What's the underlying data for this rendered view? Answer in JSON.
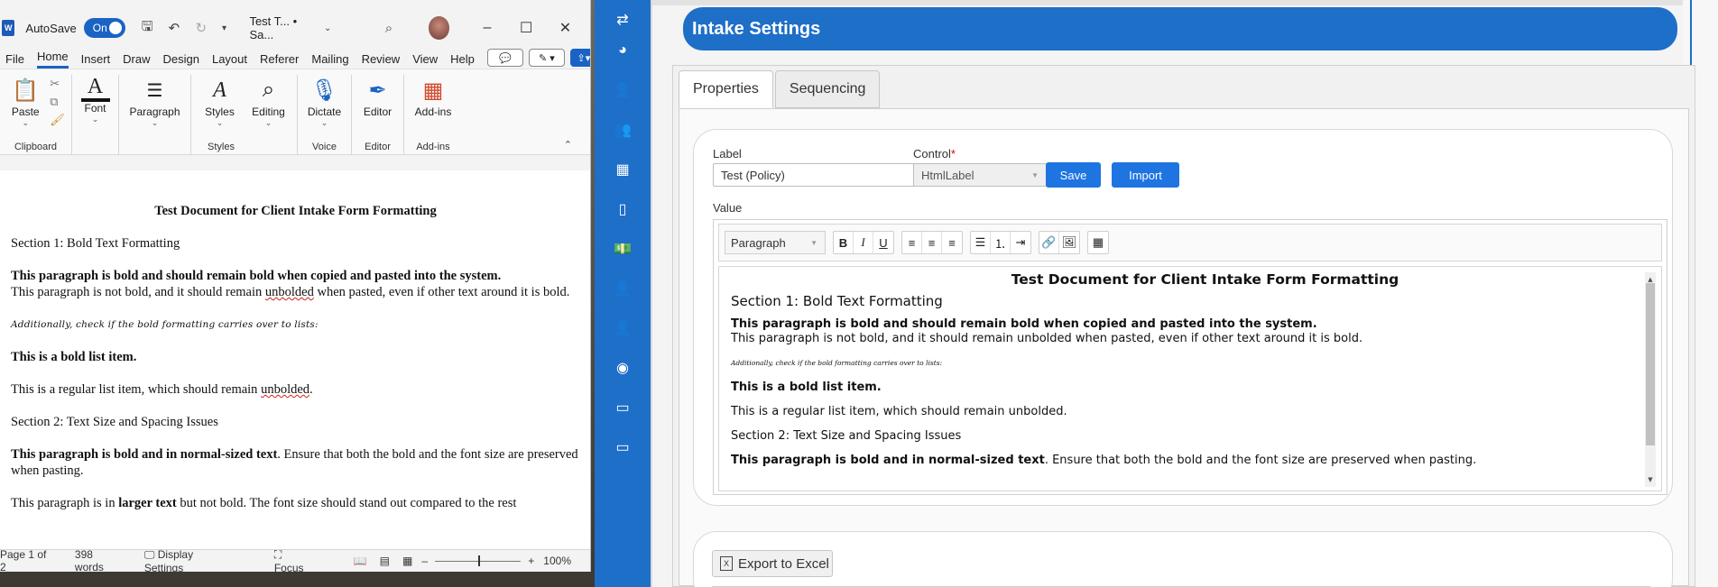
{
  "word": {
    "autosave_label": "AutoSave",
    "autosave_state": "On",
    "doc_title": "Test T... • Sa...",
    "menu": [
      "File",
      "Home",
      "Insert",
      "Draw",
      "Design",
      "Layout",
      "Referer",
      "Mailing",
      "Review",
      "View",
      "Help"
    ],
    "ribbon": {
      "paste": "Paste",
      "clipboard": "Clipboard",
      "font": "Font",
      "paragraph": "Paragraph",
      "styles": "Styles",
      "styles_group": "Styles",
      "editing": "Editing",
      "dictate": "Dictate",
      "voice": "Voice",
      "editor": "Editor",
      "editor_group": "Editor",
      "addins": "Add-ins",
      "addins_group": "Add-ins"
    },
    "page": {
      "title": "Test Document for Client Intake Form Formatting",
      "section1": "Section 1: Bold Text Formatting",
      "bold_para": "This paragraph is bold and should remain bold when copied and pasted into the system.",
      "not_bold_para_a": "This paragraph is not bold, and it should remain ",
      "not_bold_para_word": "unbolded",
      "not_bold_para_b": " when pasted, even if other text around it is bold.",
      "script_line": "Additionally, check if the bold formatting carries over to lists:",
      "bold_list": "This is a bold list item.",
      "regular_list_a": "This is a regular list item, which should remain ",
      "regular_list_word": "unbolded",
      "regular_list_b": ".",
      "section2": "Section 2: Text Size and Spacing Issues",
      "normal_bold": "This paragraph is bold and in normal-sized text",
      "normal_rest": ". Ensure that both the bold and the font size are preserved when pasting.",
      "larger_a": "This paragraph is in ",
      "larger_b": "larger text",
      "larger_c": " but not bold. The font size should stand out compared to the rest"
    },
    "status": {
      "page": "Page 1 of 2",
      "words": "398 words",
      "display": "Display Settings",
      "focus": "Focus",
      "zoom": "100%"
    }
  },
  "app": {
    "header_title": "Intake Settings",
    "tabs": [
      "Properties",
      "Sequencing"
    ],
    "form": {
      "label_caption": "Label",
      "label_value": "Test (Policy)",
      "control_caption": "Control",
      "control_required": "*",
      "control_value": "HtmlLabel",
      "save": "Save",
      "import": "Import",
      "value_caption": "Value"
    },
    "editor": {
      "block_format": "Paragraph",
      "content": {
        "title": "Test Document for Client Intake Form Formatting",
        "section1": "Section 1: Bold Text Formatting",
        "bold_para": "This paragraph is bold and should remain bold when copied and pasted into the system.",
        "not_bold_para": "This paragraph is not bold, and it should remain unbolded when pasted, even if other text around it is bold.",
        "script_line": "Additionally, check if the bold formatting carries over to lists:",
        "bold_list": "This is a bold list item.",
        "regular_list": "This is a regular list item, which should remain unbolded.",
        "section2": "Section 2: Text Size and Spacing Issues",
        "normal_bold": "This paragraph is bold and in normal-sized text",
        "normal_rest": ". Ensure that both the bold and the font size are preserved when pasting."
      }
    },
    "export": "Export to Excel"
  },
  "colors": {
    "accent": "#1e6fc8",
    "word_blue": "#1a63c4"
  }
}
